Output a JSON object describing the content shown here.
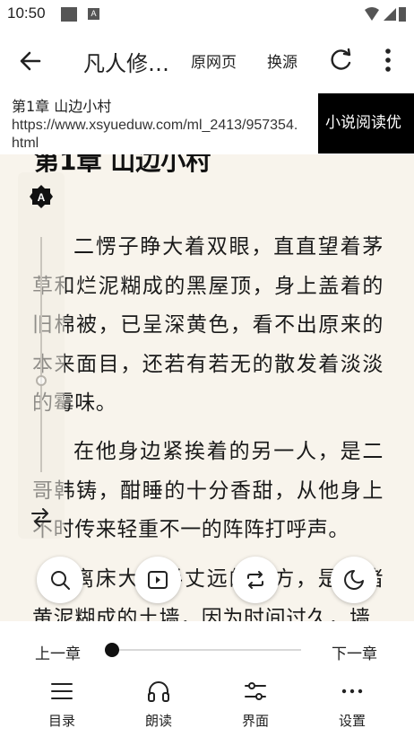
{
  "status": {
    "time": "10:50",
    "notif_letter": "A"
  },
  "toolbar": {
    "title": "凡人修…",
    "original_page": "原网页",
    "change_source": "换源"
  },
  "chapter_info": {
    "title": "第1章 山边小村",
    "url": "https://www.xsyueduw.com/ml_2413/957354.html",
    "button_label": "小说阅读优"
  },
  "reader": {
    "heading_partial": "第1章 山边小村",
    "paragraphs": [
      "二愣子睁大着双眼，直直望着茅草和烂泥糊成的黑屋顶，身上盖着的旧棉被，已呈深黄色，看不出原来的本来面目，还若有若无的散发着淡淡的霉味。",
      "在他身边紧挨着的另一人，是二哥韩铸，酣睡的十分香甜，从他身上不时传来轻重不一的阵阵打呼声。",
      "离床大约半丈远的地方，是一堵黄泥糊成的土墙，因为时间过久，墙"
    ]
  },
  "side_panel": {
    "auto_brightness_letter": "A"
  },
  "bottom_menu": {
    "prev_chapter": "上一章",
    "next_chapter": "下一章",
    "progress": 0,
    "items": [
      {
        "label": "目录",
        "icon": "menu-list-icon"
      },
      {
        "label": "朗读",
        "icon": "headphones-icon"
      },
      {
        "label": "界面",
        "icon": "sliders-icon"
      },
      {
        "label": "设置",
        "icon": "more-horizontal-icon"
      }
    ]
  },
  "floating_buttons": [
    {
      "icon": "search-icon"
    },
    {
      "icon": "auto-page-icon"
    },
    {
      "icon": "replace-icon"
    },
    {
      "icon": "night-mode-icon"
    }
  ]
}
